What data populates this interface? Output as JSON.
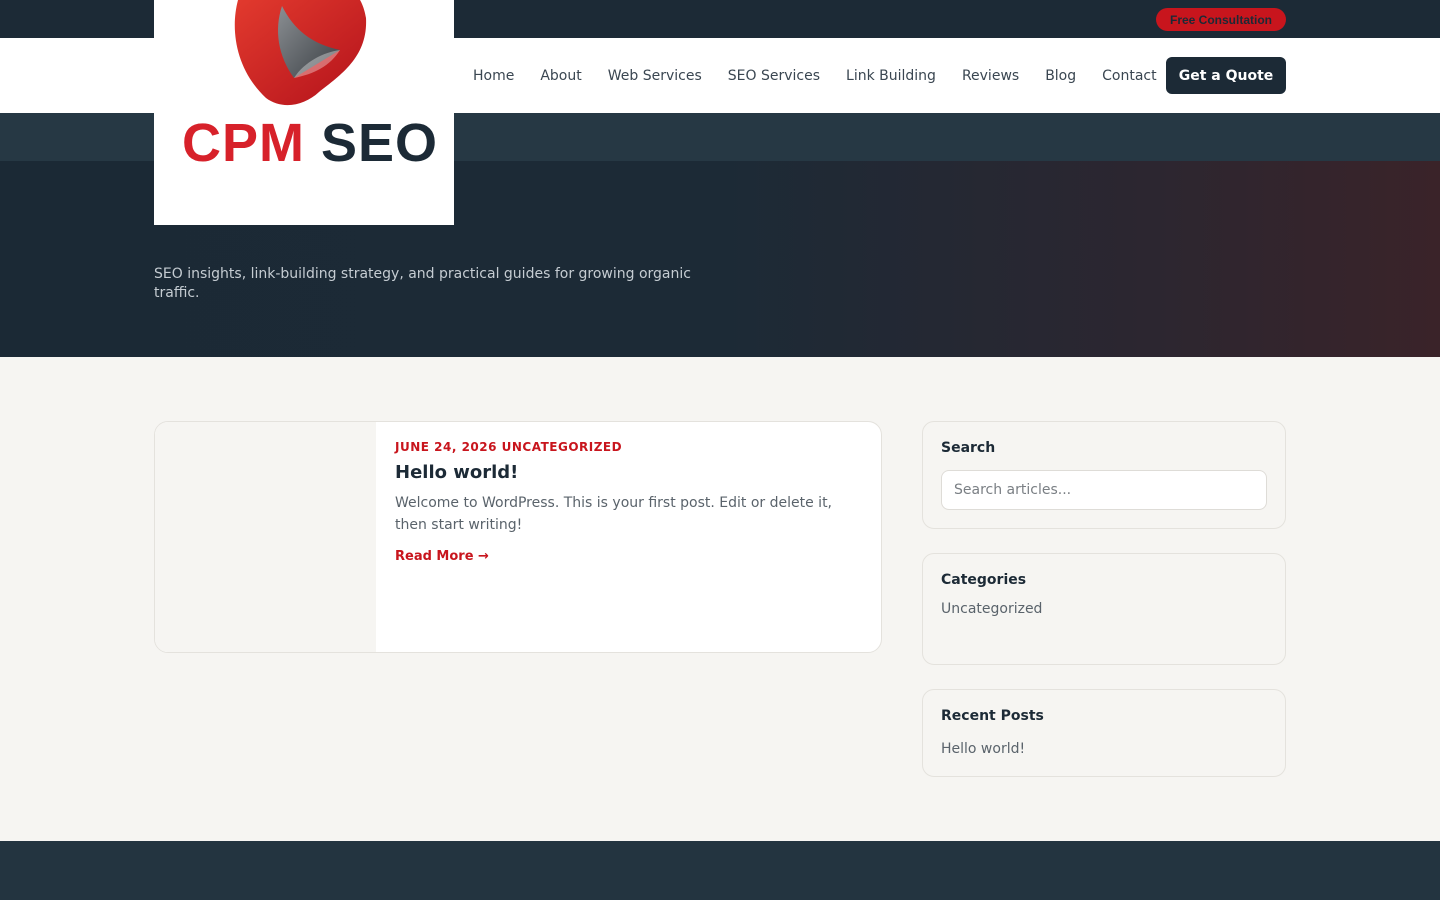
{
  "topbar": {
    "consult_label": "Free Consultation"
  },
  "brand": {
    "word_red": "CPM",
    "word_dark": "SEO",
    "red": "#d7212a",
    "dark": "#1c2a36"
  },
  "nav": {
    "items": [
      {
        "label": "Home"
      },
      {
        "label": "About"
      },
      {
        "label": "Web Services"
      },
      {
        "label": "SEO Services"
      },
      {
        "label": "Link Building"
      },
      {
        "label": "Reviews"
      },
      {
        "label": "Blog"
      },
      {
        "label": "Contact"
      }
    ],
    "cta_label": "Get a Quote"
  },
  "hero": {
    "subtitle": "SEO insights, link-building strategy, and practical guides for growing organic traffic."
  },
  "post": {
    "meta": "JUNE 24, 2026 UNCATEGORIZED",
    "title": "Hello world!",
    "excerpt": "Welcome to WordPress. This is your first post. Edit or delete it, then start writing!",
    "read_more": "Read More →"
  },
  "sidebar": {
    "search": {
      "title": "Search",
      "placeholder": "Search articles..."
    },
    "categories": {
      "title": "Categories",
      "items": [
        "Uncategorized"
      ]
    },
    "recent": {
      "title": "Recent Posts",
      "items": [
        "Hello world!"
      ]
    }
  },
  "colors": {
    "accent": "#c8151d",
    "navy": "#1c2a36",
    "background": "#f6f5f2"
  }
}
